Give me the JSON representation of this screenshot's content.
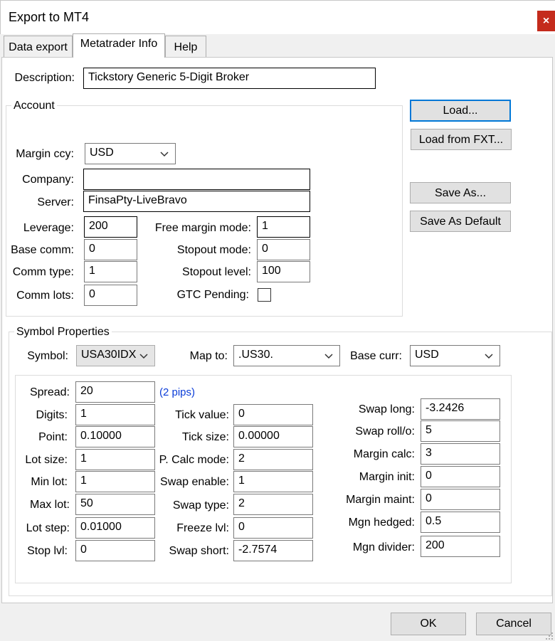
{
  "window": {
    "title": "Export to MT4",
    "close_label": "×"
  },
  "tabs": [
    {
      "label": "Data export",
      "active": false
    },
    {
      "label": "Metatrader Info",
      "active": true
    },
    {
      "label": "Help",
      "active": false
    }
  ],
  "description": {
    "label": "Description:",
    "value": "Tickstory Generic 5-Digit Broker"
  },
  "account": {
    "title": "Account",
    "margin_ccy_label": "Margin ccy:",
    "margin_ccy_value": "USD",
    "company_label": "Company:",
    "company_value": "",
    "server_label": "Server:",
    "server_value": "FinsaPty-LiveBravo",
    "leverage_label": "Leverage:",
    "leverage_value": "200",
    "base_comm_label": "Base comm:",
    "base_comm_value": "0",
    "comm_type_label": "Comm type:",
    "comm_type_value": "1",
    "comm_lots_label": "Comm lots:",
    "comm_lots_value": "0",
    "free_margin_mode_label": "Free margin mode:",
    "free_margin_mode_value": "1",
    "stopout_mode_label": "Stopout mode:",
    "stopout_mode_value": "0",
    "stopout_level_label": "Stopout level:",
    "stopout_level_value": "100",
    "gtc_pending_label": "GTC Pending:",
    "gtc_pending_checked": false
  },
  "buttons": {
    "load": "Load...",
    "load_fxt": "Load from FXT...",
    "save_as": "Save As...",
    "save_default": "Save As Default",
    "ok": "OK",
    "cancel": "Cancel"
  },
  "symbol": {
    "title": "Symbol Properties",
    "symbol_label": "Symbol:",
    "symbol_value": "USA30IDX",
    "map_to_label": "Map to:",
    "map_to_value": ".US30.",
    "base_curr_label": "Base curr:",
    "base_curr_value": "USD",
    "spread_label": "Spread:",
    "spread_value": "20",
    "spread_pips": "(2 pips)",
    "digits_label": "Digits:",
    "digits_value": "1",
    "point_label": "Point:",
    "point_value": "0.10000",
    "lot_size_label": "Lot size:",
    "lot_size_value": "1",
    "min_lot_label": "Min lot:",
    "min_lot_value": "1",
    "max_lot_label": "Max lot:",
    "max_lot_value": "50",
    "lot_step_label": "Lot step:",
    "lot_step_value": "0.01000",
    "stop_lvl_label": "Stop lvl:",
    "stop_lvl_value": "0",
    "tick_value_label": "Tick value:",
    "tick_value_value": "0",
    "tick_size_label": "Tick size:",
    "tick_size_value": "0.00000",
    "p_calc_mode_label": "P. Calc mode:",
    "p_calc_mode_value": "2",
    "swap_enable_label": "Swap enable:",
    "swap_enable_value": "1",
    "swap_type_label": "Swap type:",
    "swap_type_value": "2",
    "freeze_lvl_label": "Freeze lvl:",
    "freeze_lvl_value": "0",
    "swap_short_label": "Swap short:",
    "swap_short_value": "-2.7574",
    "swap_long_label": "Swap long:",
    "swap_long_value": "-3.2426",
    "swap_roll_label": "Swap roll/o:",
    "swap_roll_value": "5",
    "margin_calc_label": "Margin calc:",
    "margin_calc_value": "3",
    "margin_init_label": "Margin init:",
    "margin_init_value": "0",
    "margin_maint_label": "Margin maint:",
    "margin_maint_value": "0",
    "mgn_hedged_label": "Mgn hedged:",
    "mgn_hedged_value": "0.5",
    "mgn_divider_label": "Mgn divider:",
    "mgn_divider_value": "200"
  },
  "colors": {
    "close_button": "#c42b1c",
    "focus_border": "#0078d7",
    "pips_text": "#0a3cd8"
  }
}
